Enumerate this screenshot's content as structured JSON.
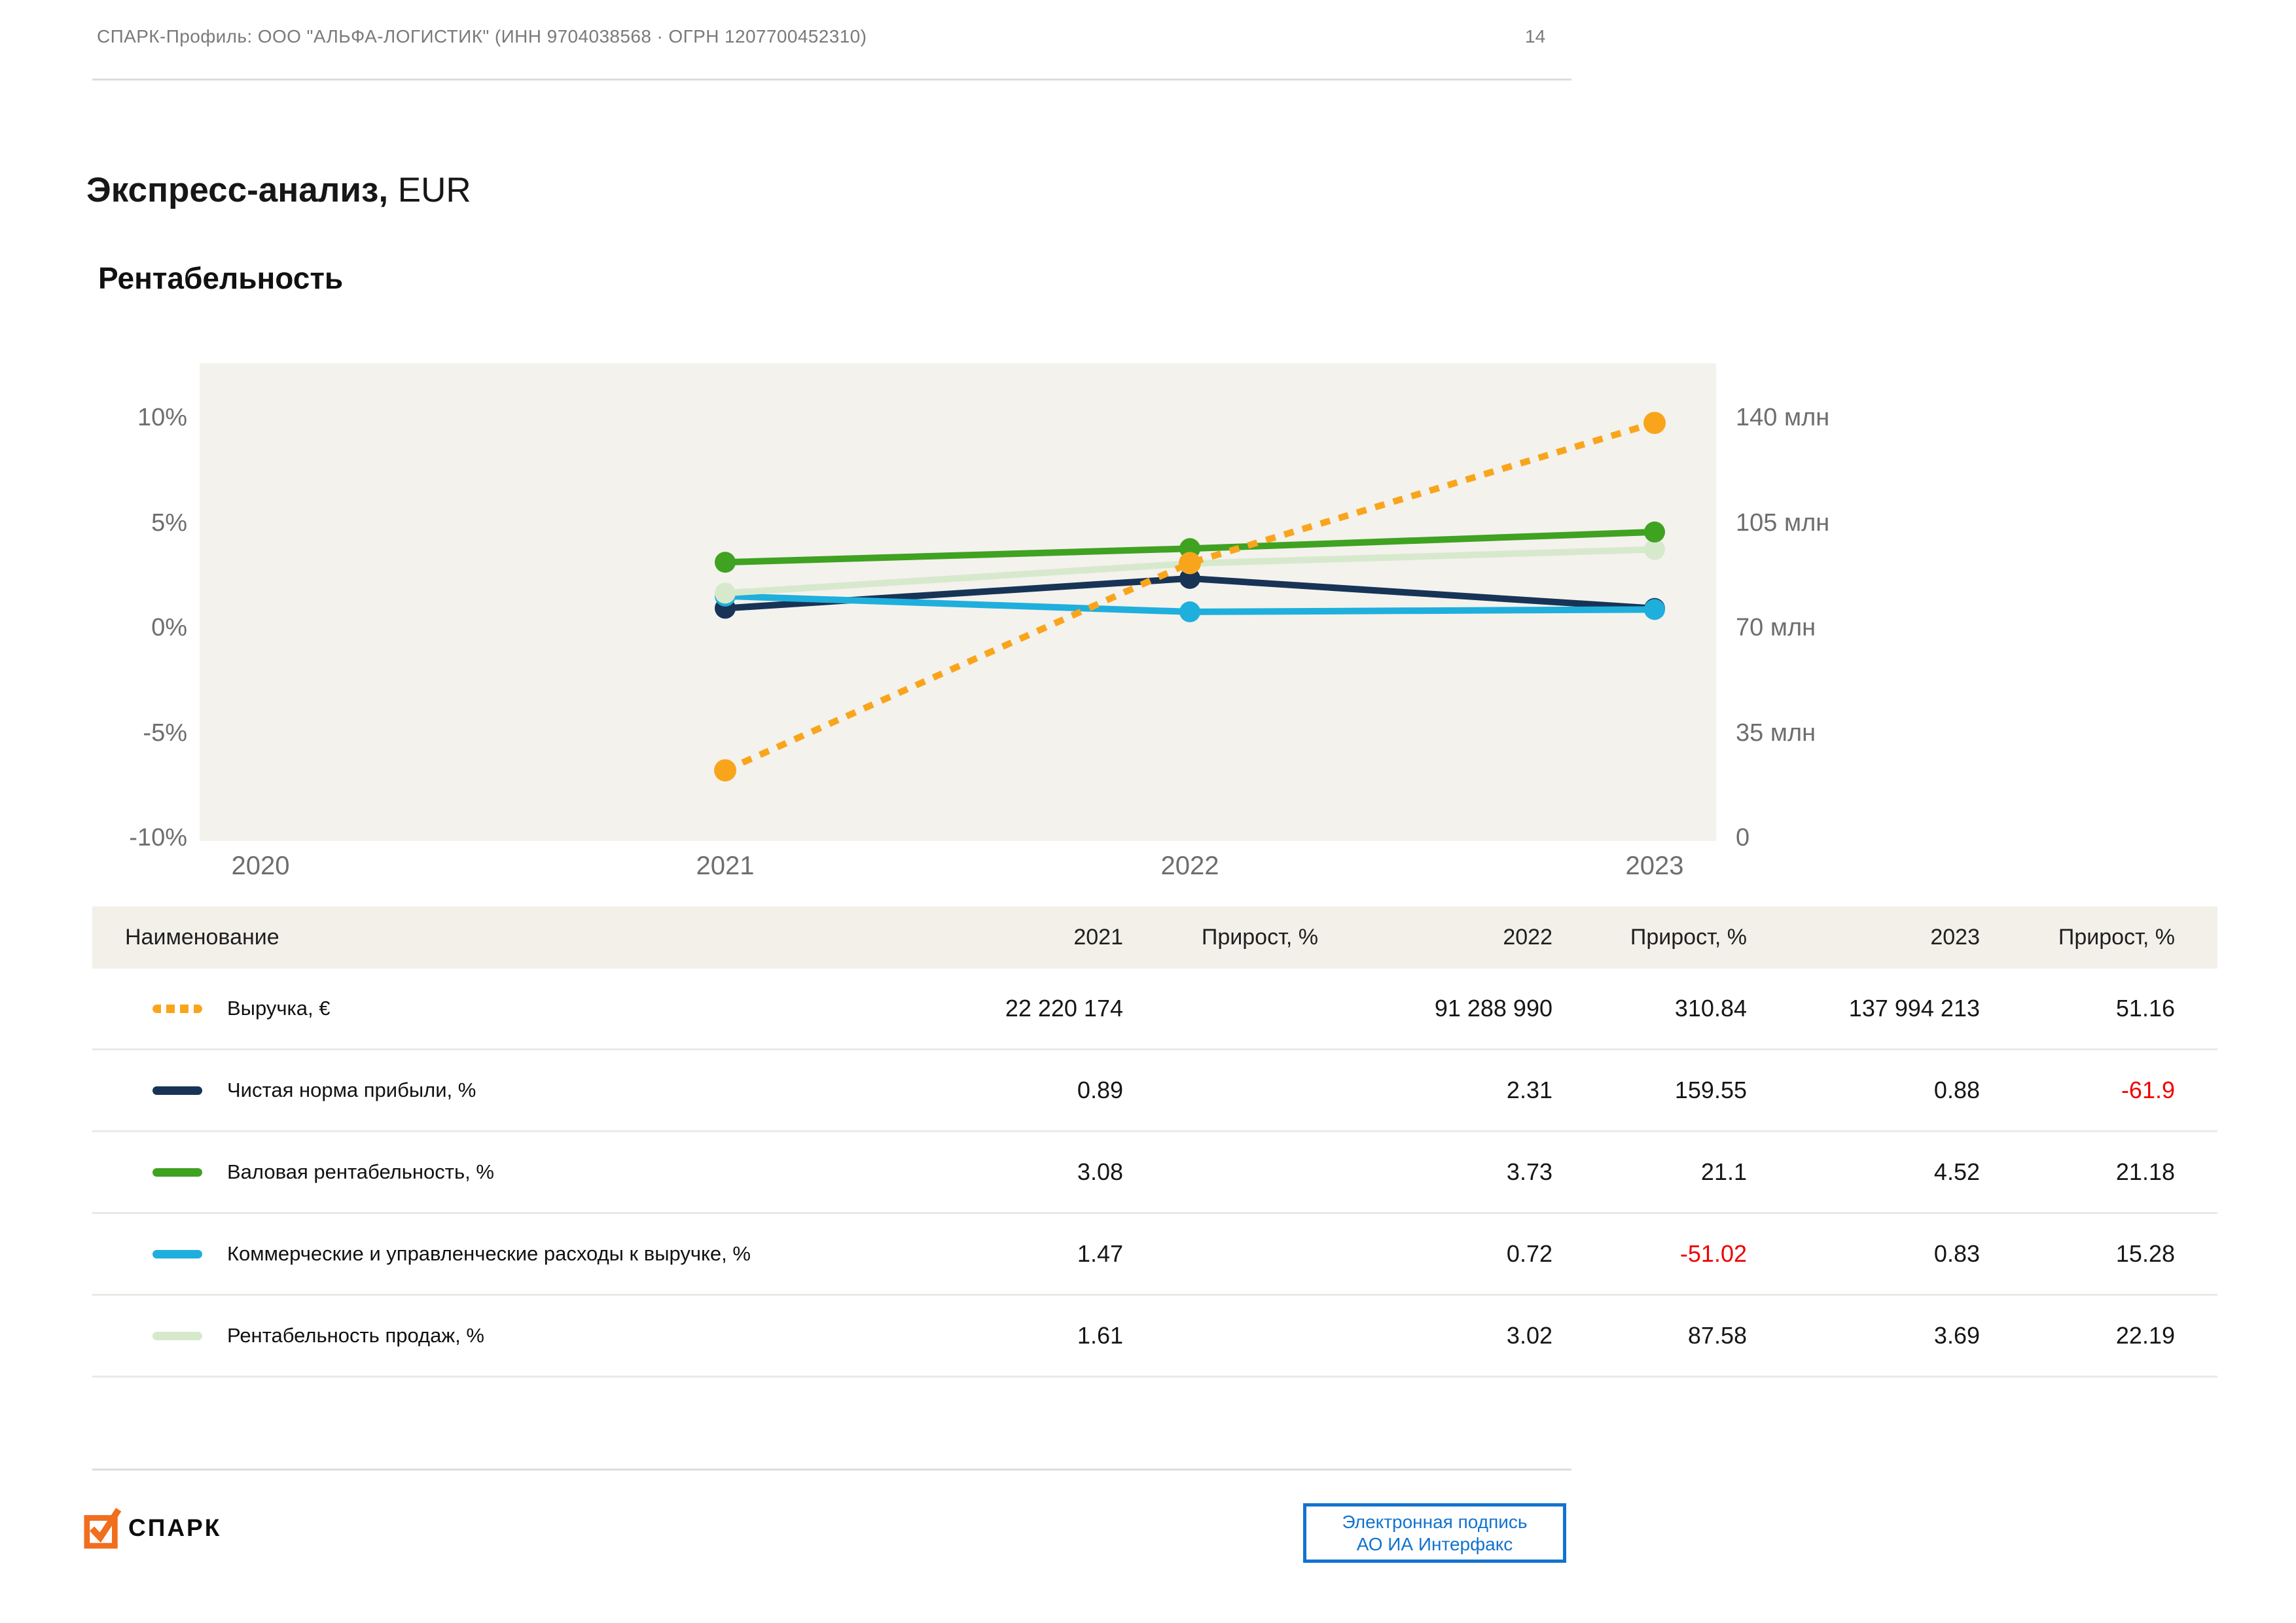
{
  "header": {
    "profile": "СПАРК-Профиль: ООО \"АЛЬФА-ЛОГИСТИК\" (ИНН 9704038568 · ОГРН 1207700452310)",
    "page_number": "14"
  },
  "title": {
    "main": "Экспресс-анализ,",
    "currency": " EUR"
  },
  "section_title": "Рентабельность",
  "chart_data": {
    "type": "line",
    "title": "Рентабельность",
    "x": [
      2020,
      2021,
      2022,
      2023
    ],
    "x_tick_labels": [
      "2020",
      "2021",
      "2022",
      "2023"
    ],
    "grid": false,
    "plot_bg": "#f4f2ed",
    "left_axis": {
      "unit": "%",
      "range": [
        -10,
        10
      ],
      "ticks": [
        10,
        5,
        0,
        -5,
        -10
      ],
      "tick_labels": [
        "10%",
        "5%",
        "0%",
        "-5%",
        "-10%"
      ]
    },
    "right_axis": {
      "unit": "млн",
      "range": [
        0,
        140
      ],
      "ticks_mln": [
        140,
        105,
        70,
        35,
        0
      ],
      "tick_labels": [
        "140 млн",
        "105 млн",
        "70 млн",
        "35 млн",
        "0"
      ]
    },
    "series": [
      {
        "name": "Выручка, €",
        "axis": "right",
        "style": "dashed",
        "color": "#F9A51C",
        "x": [
          2021,
          2022,
          2023
        ],
        "values": [
          22220174,
          91288990,
          137994213
        ]
      },
      {
        "name": "Чистая норма прибыли, %",
        "axis": "left",
        "style": "solid",
        "color": "#173457",
        "x": [
          2021,
          2022,
          2023
        ],
        "values": [
          0.89,
          2.31,
          0.88
        ]
      },
      {
        "name": "Валовая рентабельность, %",
        "axis": "left",
        "style": "solid",
        "color": "#3FA221",
        "x": [
          2021,
          2022,
          2023
        ],
        "values": [
          3.08,
          3.73,
          4.52
        ]
      },
      {
        "name": "Коммерческие и управленческие расходы к выручке, %",
        "axis": "left",
        "style": "solid",
        "color": "#1FAFDC",
        "x": [
          2021,
          2022,
          2023
        ],
        "values": [
          1.47,
          0.72,
          0.83
        ]
      },
      {
        "name": "Рентабельность продаж, %",
        "axis": "left",
        "style": "solid",
        "color": "#D7E9CC",
        "x": [
          2021,
          2022,
          2023
        ],
        "values": [
          1.61,
          3.02,
          3.69
        ]
      }
    ],
    "draw_order": [
      1,
      3,
      4,
      2,
      0
    ]
  },
  "table": {
    "columns": [
      "Наименование",
      "2021",
      "Прирост, %",
      "2022",
      "Прирост, %",
      "2023",
      "Прирост, %"
    ],
    "rows": [
      {
        "name": "Выручка, €",
        "swatch": "dashed",
        "color": "#F9A51C",
        "values": [
          "22 220 174",
          "",
          "91 288 990",
          "310.84",
          "137 994 213",
          "51.16"
        ]
      },
      {
        "name": "Чистая норма прибыли, %",
        "swatch": "solid",
        "color": "#173457",
        "values": [
          "0.89",
          "",
          "2.31",
          "159.55",
          "0.88",
          "-61.9"
        ]
      },
      {
        "name": "Валовая рентабельность, %",
        "swatch": "solid",
        "color": "#3FA221",
        "values": [
          "3.08",
          "",
          "3.73",
          "21.1",
          "4.52",
          "21.18"
        ]
      },
      {
        "name": "Коммерческие и управленческие расходы к выручке, %",
        "swatch": "solid",
        "color": "#1FAFDC",
        "values": [
          "1.47",
          "",
          "0.72",
          "-51.02",
          "0.83",
          "15.28"
        ]
      },
      {
        "name": "Рентабельность продаж, %",
        "swatch": "solid",
        "color": "#D7E9CC",
        "values": [
          "1.61",
          "",
          "3.02",
          "87.58",
          "3.69",
          "22.19"
        ]
      }
    ]
  },
  "footer": {
    "logo_text": "СПАРК",
    "logo_color": "#F06E1E",
    "signature_line1": "Электронная подпись",
    "signature_line2": "АО ИА Интерфакс",
    "signature_color": "#1173cf"
  }
}
